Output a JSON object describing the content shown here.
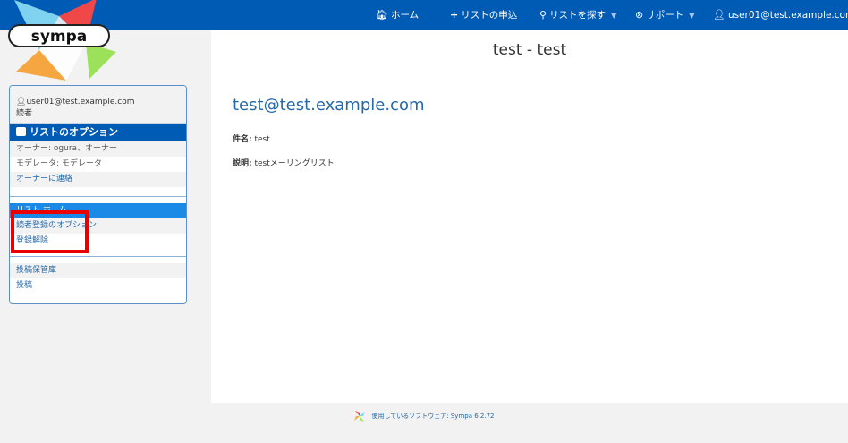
{
  "nav": {
    "home": "ホーム",
    "request_list": "リストの申込",
    "find_list": "リストを探す",
    "support": "サポート",
    "user": "user01@test.example.com"
  },
  "logo_text": "sympa",
  "main": {
    "list_title": "test - test",
    "list_email": "test@test.example.com",
    "subject_label": "件名:",
    "subject_value": "test",
    "description_label": "説明:",
    "description_value": "testメーリングリスト"
  },
  "sidebar": {
    "user_email": "user01@test.example.com",
    "user_role": "読者",
    "options_header": "リストのオプション",
    "owner": "オーナー: ogura、オーナー",
    "moderator": "モデレータ: モデレータ",
    "contact_owner": "オーナーに連絡",
    "list_home": "リスト ホーム",
    "subscriber_options": "読者登録のオプション",
    "unsubscribe": "登録解除",
    "archives": "投稿保管庫",
    "post": "投稿"
  },
  "footer": {
    "text": "使用しているソフトウェア: Sympa 6.2.72"
  },
  "colors": {
    "nav_bg": "#005bb5",
    "active_item": "#1a8ae6",
    "link": "#2468a8",
    "highlight": "#ea0000"
  }
}
